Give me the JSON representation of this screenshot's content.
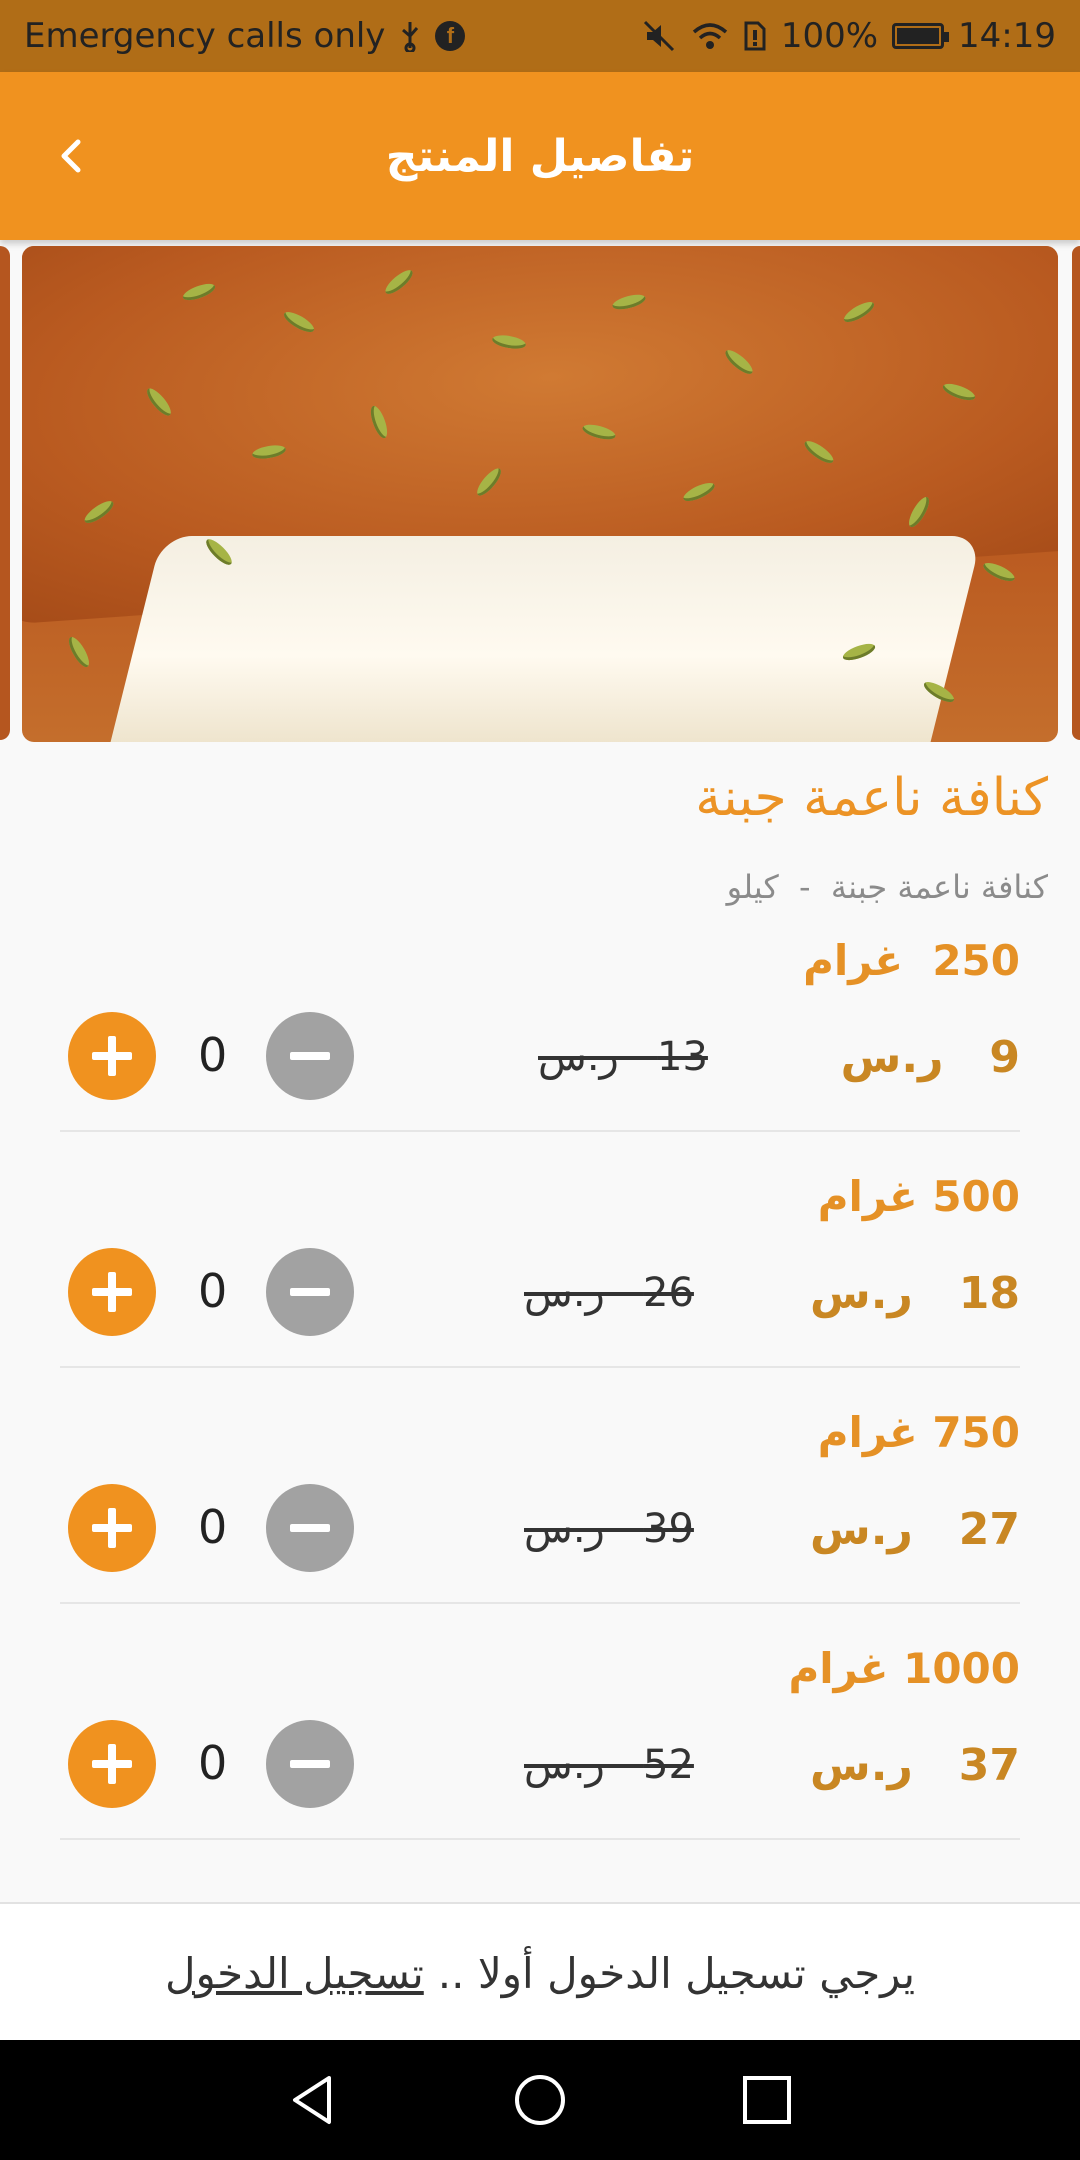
{
  "status_bar": {
    "carrier": "Emergency calls only",
    "battery": "100%",
    "time": "14:19",
    "icons": [
      "usb-icon",
      "facebook-icon",
      "mute-icon",
      "wifi-icon",
      "sim-icon",
      "battery-icon"
    ]
  },
  "appbar": {
    "title": "تفاصيل المنتج",
    "back_icon": "chevron-left-icon"
  },
  "product": {
    "title": "كنافة ناعمة جبنة",
    "subtitle": "كنافة ناعمة جبنة  -  كيلو",
    "colors": {
      "accent": "#f0921f",
      "title": "#ec9325",
      "price": "#c98723",
      "minus": "#a2a2a2"
    }
  },
  "options": [
    {
      "weight": "250  غرام",
      "price_now": "9   ر.س",
      "price_old": "13   ر.س",
      "qty": "0"
    },
    {
      "weight": "500 غرام",
      "price_now": "18   ر.س",
      "price_old": "26   ر.س",
      "qty": "0"
    },
    {
      "weight": "750 غرام",
      "price_now": "27   ر.س",
      "price_old": "39   ر.س",
      "qty": "0"
    },
    {
      "weight": "1000 غرام",
      "price_now": "37   ر.س",
      "price_old": "52   ر.س",
      "qty": "0"
    }
  ],
  "login": {
    "prompt": "يرجي تسجيل الدخول أولا ..",
    "link": "تسجيل الدخول"
  },
  "navbar": {
    "icons": [
      "back-triangle-icon",
      "home-circle-icon",
      "recents-square-icon"
    ]
  }
}
